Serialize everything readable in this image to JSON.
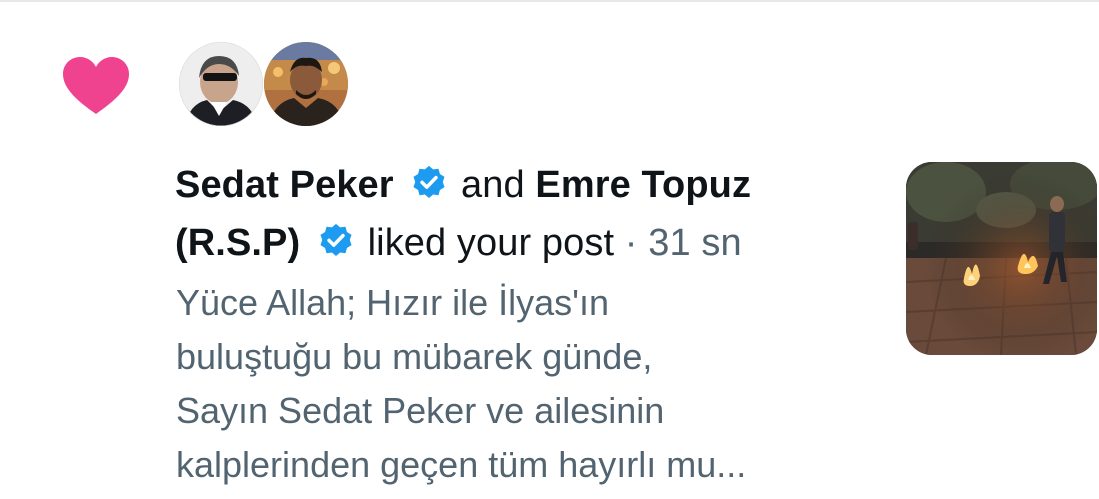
{
  "notification": {
    "type_icon": "heart-icon",
    "accent_color": "#f0438f",
    "verified_color": "#1d9bf0",
    "users": [
      {
        "name": "Sedat Peker",
        "verified": true,
        "avatar": "avatar-sedat-peker"
      },
      {
        "name": "Emre Topuz (R.S.P)",
        "verified": true,
        "avatar": "avatar-emre-topuz"
      }
    ],
    "name_1": "Sedat Peker",
    "conjunction": "and",
    "name_2": "Emre Topuz (R.S.P)",
    "action": "liked your post",
    "separator": "·",
    "timestamp": "31 sn"
  },
  "post": {
    "preview_lines": [
      "Yüce Allah; Hızır ile İlyas'ın",
      "buluştuğu bu mübarek günde,",
      "Sayın Sedat Peker ve ailesinin",
      "kalplerinden geçen tüm hayırlı mu..."
    ],
    "media": "video-thumbnail"
  }
}
